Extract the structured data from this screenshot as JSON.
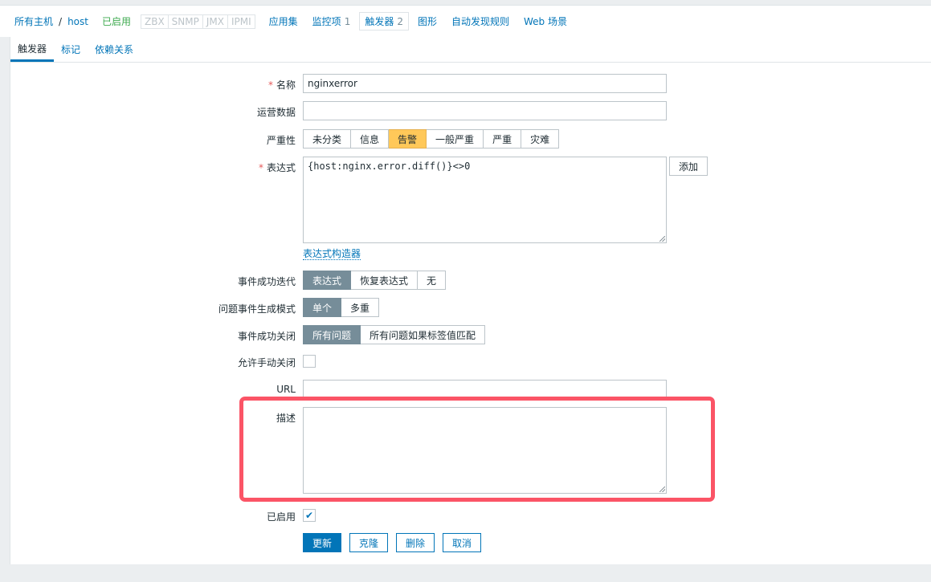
{
  "breadcrumb": {
    "all_hosts": "所有主机",
    "separator": "/",
    "host": "host",
    "status": "已启用",
    "protocols": [
      "ZBX",
      "SNMP",
      "JMX",
      "IPMI"
    ],
    "links": [
      {
        "label": "应用集",
        "count": ""
      },
      {
        "label": "监控项",
        "count": "1"
      },
      {
        "label": "触发器",
        "count": "2"
      },
      {
        "label": "图形",
        "count": ""
      },
      {
        "label": "自动发现规则",
        "count": ""
      },
      {
        "label": "Web 场景",
        "count": ""
      }
    ]
  },
  "tabs": [
    "触发器",
    "标记",
    "依赖关系"
  ],
  "form": {
    "name": {
      "label": "名称",
      "value": "nginxerror"
    },
    "opdata": {
      "label": "运营数据",
      "value": ""
    },
    "severity": {
      "label": "严重性",
      "options": [
        "未分类",
        "信息",
        "告警",
        "一般严重",
        "严重",
        "灾难"
      ],
      "selected": "告警"
    },
    "expression": {
      "label": "表达式",
      "value": "{host:nginx.error.diff()}<>0",
      "add_button": "添加",
      "builder_link": "表达式构造器"
    },
    "ok_event": {
      "label": "事件成功迭代",
      "options": [
        "表达式",
        "恢复表达式",
        "无"
      ],
      "selected": "表达式"
    },
    "problem_mode": {
      "label": "问题事件生成模式",
      "options": [
        "单个",
        "多重"
      ],
      "selected": "单个"
    },
    "ok_close": {
      "label": "事件成功关闭",
      "options": [
        "所有问题",
        "所有问题如果标签值匹配"
      ],
      "selected": "所有问题"
    },
    "manual_close": {
      "label": "允许手动关闭",
      "checked": false
    },
    "url": {
      "label": "URL",
      "value": ""
    },
    "description": {
      "label": "描述",
      "value": ""
    },
    "enabled": {
      "label": "已启用",
      "checked": true
    },
    "buttons": {
      "update": "更新",
      "clone": "克隆",
      "delete": "删除",
      "cancel": "取消"
    }
  },
  "colors": {
    "accent": "#0275b8",
    "warning_selected": "#ffc859",
    "highlight_box": "#fb5466",
    "selected_gray": "#768d99"
  }
}
